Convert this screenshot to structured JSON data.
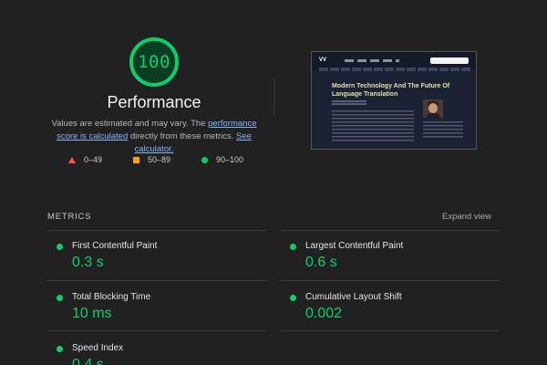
{
  "score": {
    "value": "100",
    "fraction": 1.0,
    "color": "#0cce6b"
  },
  "title": "Performance",
  "description": {
    "prefix": "Values are estimated and may vary. The ",
    "link1": "performance score is calculated",
    "middle": " directly from these metrics. ",
    "link2": "See calculator."
  },
  "legend": [
    {
      "icon": "fail-triangle-icon",
      "range": "0–49",
      "color": "#ff4e42"
    },
    {
      "icon": "average-square-icon",
      "range": "50–89",
      "color": "#ffa400"
    },
    {
      "icon": "pass-circle-icon",
      "range": "90–100",
      "color": "#0cce6b"
    }
  ],
  "screenshot": {
    "logo": "VV",
    "article_title": "Modern Technology And The Future Of Language Translation"
  },
  "metrics": {
    "heading": "METRICS",
    "expand_label": "Expand view",
    "items": [
      {
        "name": "First Contentful Paint",
        "value": "0.3 s"
      },
      {
        "name": "Largest Contentful Paint",
        "value": "0.6 s"
      },
      {
        "name": "Total Blocking Time",
        "value": "10 ms"
      },
      {
        "name": "Cumulative Layout Shift",
        "value": "0.002"
      },
      {
        "name": "Speed Index",
        "value": "0.4 s"
      }
    ]
  }
}
